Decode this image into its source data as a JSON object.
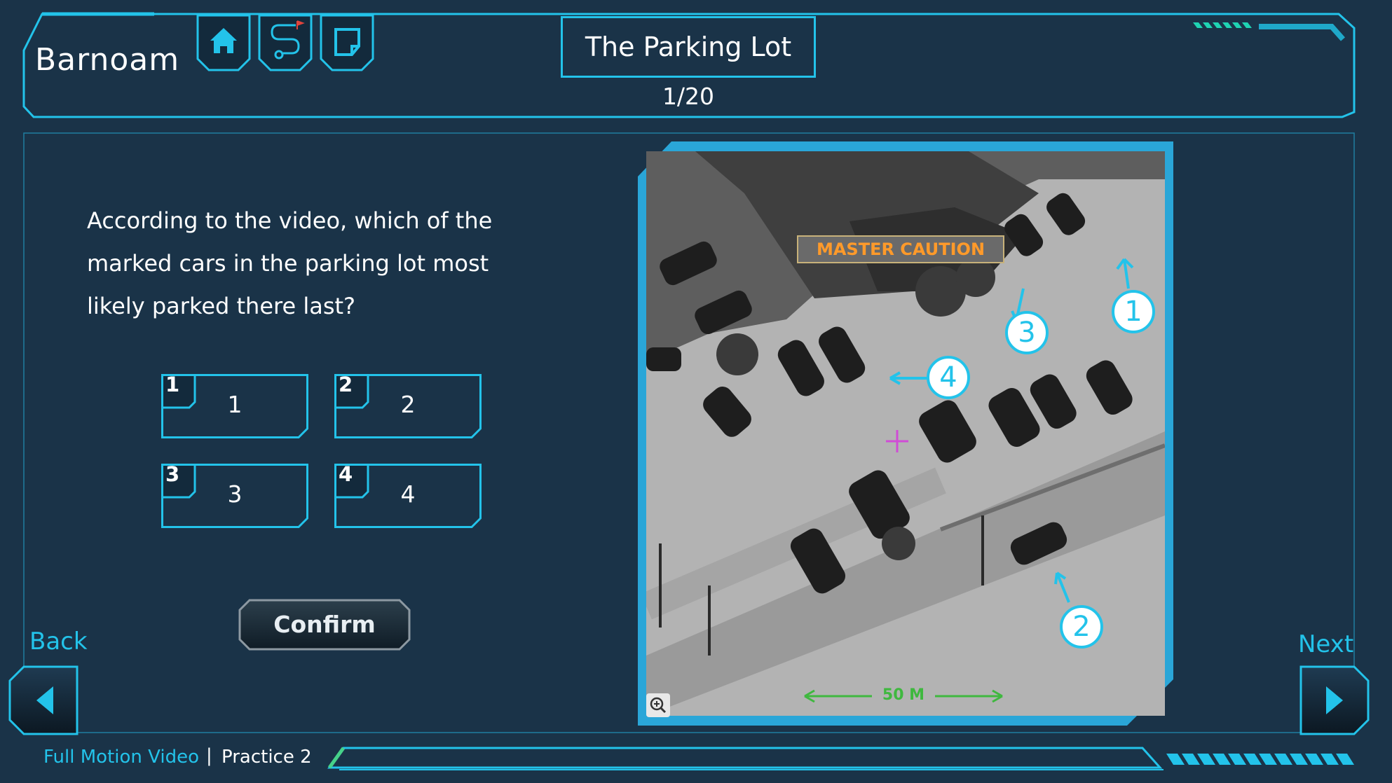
{
  "header": {
    "logo": "Barnoam",
    "title": "The Parking Lot",
    "page_counter": "1/20",
    "buttons": [
      {
        "icon": "home-icon"
      },
      {
        "icon": "route-map-icon"
      },
      {
        "icon": "note-icon"
      }
    ]
  },
  "question": {
    "text": "According to the video, which of the marked cars in the parking lot most likely parked there last?"
  },
  "answers": [
    {
      "badge": "1",
      "label": "1"
    },
    {
      "badge": "2",
      "label": "2"
    },
    {
      "badge": "3",
      "label": "3"
    },
    {
      "badge": "4",
      "label": "4"
    }
  ],
  "confirm_label": "Confirm",
  "video": {
    "overlay_text": "MASTER CAUTION",
    "scale_text": "50 M",
    "markers": [
      "1",
      "2",
      "3",
      "4"
    ],
    "zoom_icon": "zoom-in-icon"
  },
  "nav": {
    "back_label": "Back",
    "next_label": "Next"
  },
  "footer": {
    "course": "Full Motion Video",
    "separator": "|",
    "lesson": "Practice 2"
  },
  "colors": {
    "background": "#1a3348",
    "accent": "#23c3ea",
    "panel": "#183247"
  }
}
